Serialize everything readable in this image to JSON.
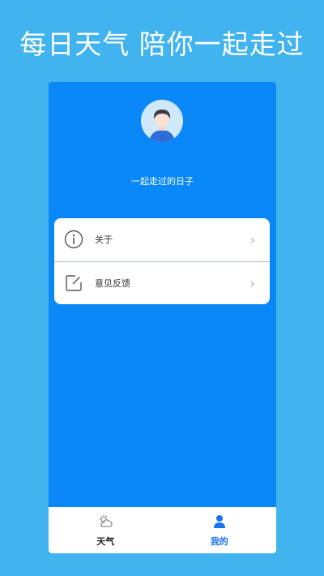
{
  "headline": "每日天气 陪你一起走过",
  "profile": {
    "tagline": "一起走过的日子"
  },
  "menu": {
    "items": [
      {
        "label": "关于",
        "icon": "info-icon"
      },
      {
        "label": "意见反馈",
        "icon": "edit-icon"
      }
    ]
  },
  "tabbar": {
    "tabs": [
      {
        "label": "天气",
        "icon": "weather-icon",
        "color": "#222222"
      },
      {
        "label": "我的",
        "icon": "user-icon",
        "color": "#1a73e8",
        "active": true
      }
    ]
  },
  "colors": {
    "page_background": "#41b3ee",
    "panel_background": "#0a88f8",
    "accent": "#1a73e8"
  }
}
